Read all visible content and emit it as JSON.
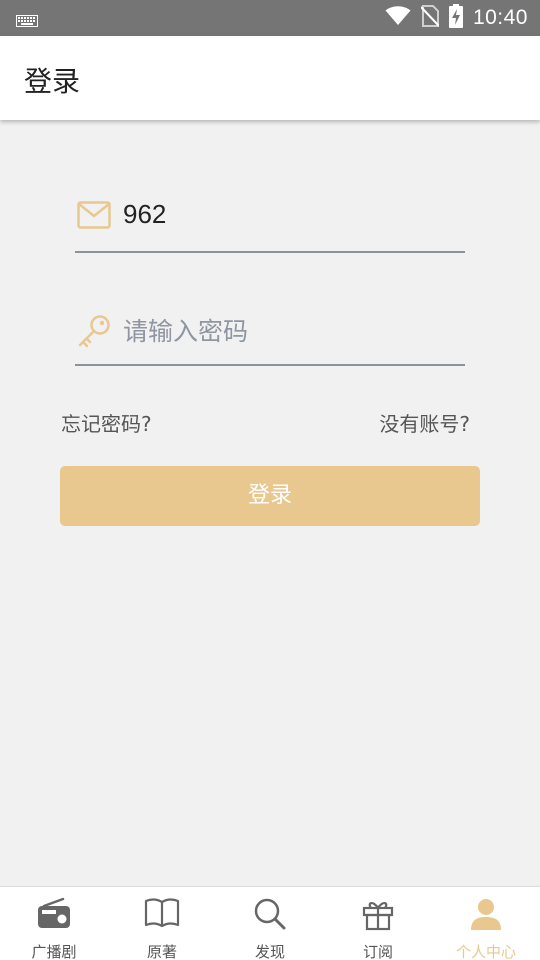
{
  "status_bar": {
    "time": "10:40",
    "icons": [
      "keyboard-icon",
      "wifi-icon",
      "no-sim-icon",
      "battery-charging-icon"
    ]
  },
  "header": {
    "title": "登录"
  },
  "form": {
    "email_value": "962",
    "email_icon": "mail-icon",
    "password_placeholder": "请输入密码",
    "password_icon": "key-icon",
    "forgot_label": "忘记密码?",
    "register_label": "没有账号?",
    "login_label": "登录"
  },
  "nav": {
    "items": [
      {
        "label": "广播剧",
        "icon": "radio-icon",
        "active": false
      },
      {
        "label": "原著",
        "icon": "book-icon",
        "active": false
      },
      {
        "label": "发现",
        "icon": "search-icon",
        "active": false
      },
      {
        "label": "订阅",
        "icon": "gift-icon",
        "active": false
      },
      {
        "label": "个人中心",
        "icon": "person-icon",
        "active": true
      }
    ]
  },
  "colors": {
    "accent": "#e8c88f",
    "status_bar": "#757575",
    "background": "#f1f1f1",
    "underline": "#8a929c"
  }
}
